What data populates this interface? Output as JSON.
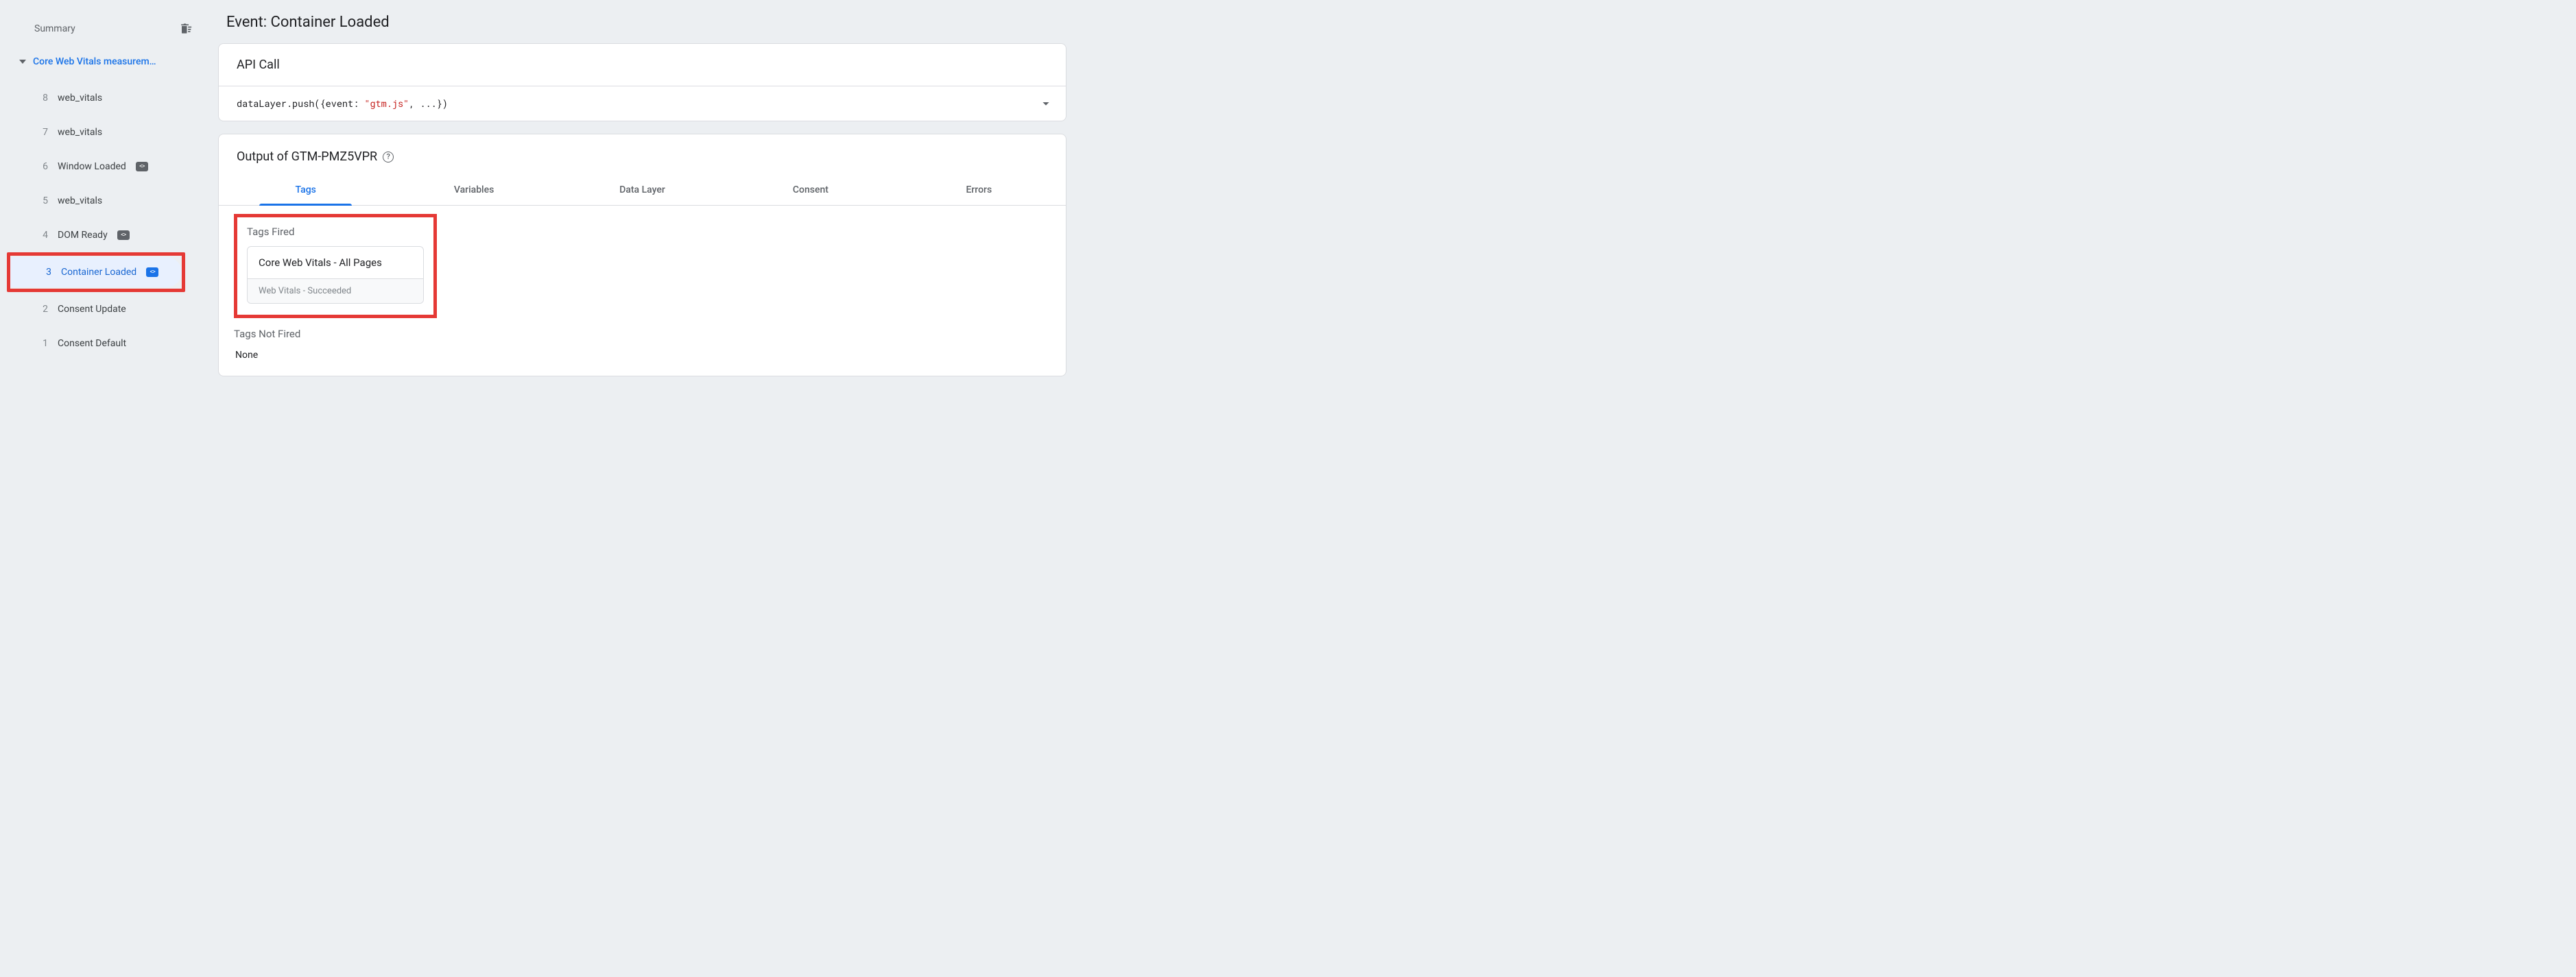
{
  "sidebar": {
    "summary_label": "Summary",
    "group_label": "Core Web Vitals measurem…",
    "events": [
      {
        "num": "8",
        "label": "web_vitals",
        "has_chip": false,
        "active": false
      },
      {
        "num": "7",
        "label": "web_vitals",
        "has_chip": false,
        "active": false
      },
      {
        "num": "6",
        "label": "Window Loaded",
        "has_chip": true,
        "active": false
      },
      {
        "num": "5",
        "label": "web_vitals",
        "has_chip": false,
        "active": false
      },
      {
        "num": "4",
        "label": "DOM Ready",
        "has_chip": true,
        "active": false
      },
      {
        "num": "3",
        "label": "Container Loaded",
        "has_chip": true,
        "active": true
      },
      {
        "num": "2",
        "label": "Consent Update",
        "has_chip": false,
        "active": false
      },
      {
        "num": "1",
        "label": "Consent Default",
        "has_chip": false,
        "active": false
      }
    ]
  },
  "main": {
    "page_title": "Event: Container Loaded",
    "api_call": {
      "heading": "API Call",
      "code_prefix": "dataLayer.push({event: ",
      "code_string": "\"gtm.js\"",
      "code_suffix": ", ...})"
    },
    "output": {
      "heading": "Output of GTM-PMZ5VPR",
      "tabs": [
        "Tags",
        "Variables",
        "Data Layer",
        "Consent",
        "Errors"
      ],
      "active_tab_index": 0,
      "tags_fired_label": "Tags Fired",
      "fired_tag": {
        "title": "Core Web Vitals - All Pages",
        "subtitle": "Web Vitals - Succeeded"
      },
      "tags_not_fired_label": "Tags Not Fired",
      "tags_not_fired_value": "None"
    }
  }
}
